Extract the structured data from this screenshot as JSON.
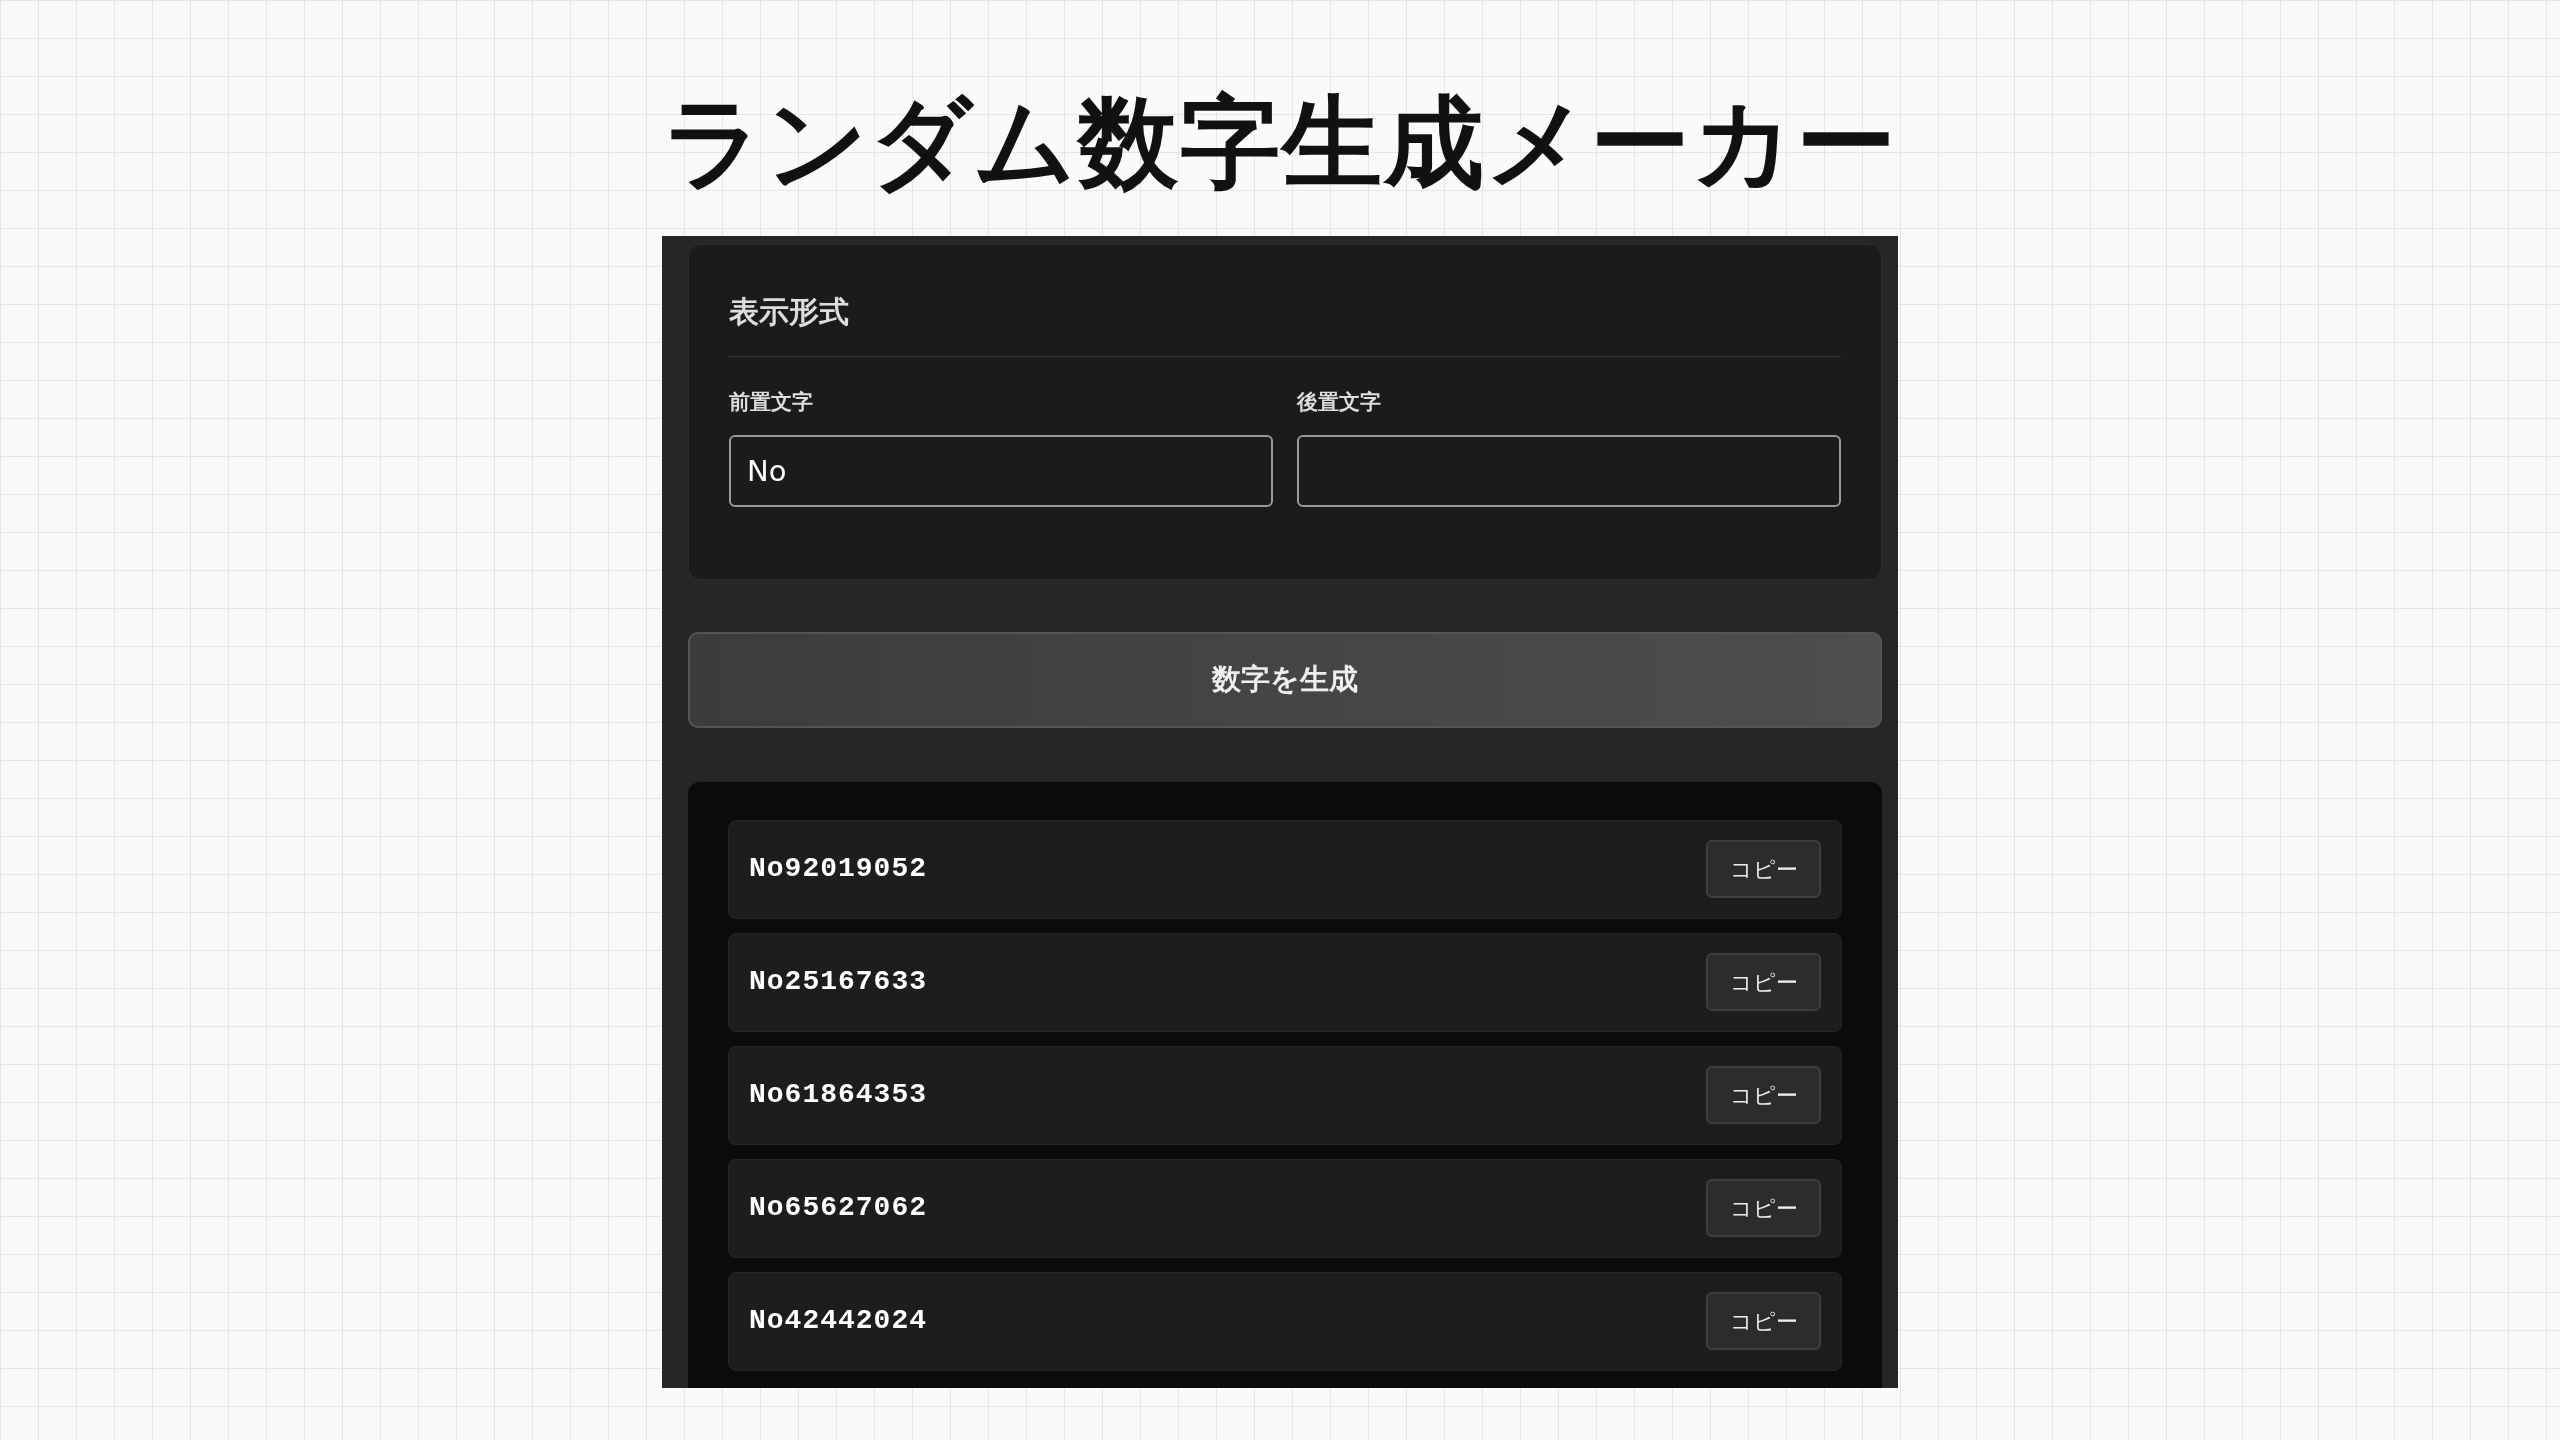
{
  "title": "ランダム数字生成メーカー",
  "settings": {
    "heading": "表示形式",
    "fields": [
      {
        "label": "前置文字",
        "value": "No"
      },
      {
        "label": "後置文字"
      }
    ]
  },
  "generate_button": "数字を生成",
  "results": [
    {
      "number": "No92019052",
      "button": "コピー"
    },
    {
      "number": "No25167633",
      "button": "コピー"
    },
    {
      "number": "No61864353",
      "button": "コピー"
    },
    {
      "number": "No65627062",
      "button": "コピー"
    },
    {
      "number": "No42442024",
      "button": "コピー"
    }
  ]
}
